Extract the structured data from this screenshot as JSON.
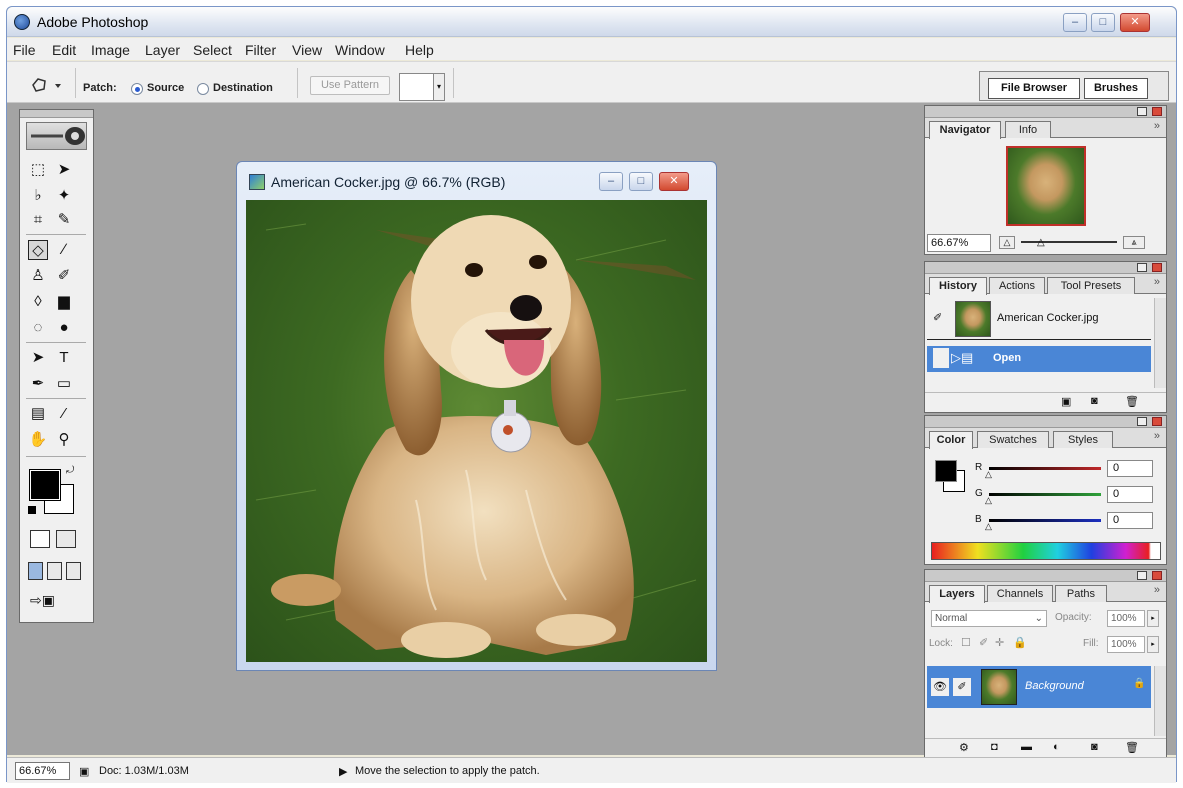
{
  "window": {
    "title": "Adobe Photoshop",
    "controls": {
      "minimize": "–",
      "maximize": "□",
      "close": "✕"
    }
  },
  "menu": {
    "items": [
      "File",
      "Edit",
      "Image",
      "Layer",
      "Select",
      "Filter",
      "View",
      "Window",
      "Help"
    ]
  },
  "options": {
    "tool_icon": "patch-tool-icon",
    "patch_label": "Patch:",
    "source_label": "Source",
    "destination_label": "Destination",
    "source_selected": true,
    "use_pattern_label": "Use Pattern",
    "dropdown_arrow": "▾",
    "well_tabs": [
      "File Browser",
      "Brushes"
    ]
  },
  "document": {
    "title": "American Cocker.jpg @ 66.7% (RGB)",
    "controls": {
      "minimize": "–",
      "maximize": "□",
      "close": "✕"
    },
    "image_subject": "cocker-spaniel-on-grass"
  },
  "panels": {
    "navigator": {
      "tabs": [
        "Navigator",
        "Info"
      ],
      "zoom_value": "66.67%",
      "menu_glyph": "»"
    },
    "history": {
      "tabs": [
        "History",
        "Actions",
        "Tool Presets"
      ],
      "snapshot_label": "American Cocker.jpg",
      "states": [
        "Open"
      ],
      "menu_glyph": "»"
    },
    "color": {
      "tabs": [
        "Color",
        "Swatches",
        "Styles"
      ],
      "channels": [
        {
          "label": "R",
          "value": "0",
          "color": "#c0282a"
        },
        {
          "label": "G",
          "value": "0",
          "color": "#2fa23a"
        },
        {
          "label": "B",
          "value": "0",
          "color": "#1c2fc0"
        }
      ],
      "menu_glyph": "»"
    },
    "layers": {
      "tabs": [
        "Layers",
        "Channels",
        "Paths"
      ],
      "blend_mode": "Normal",
      "opacity_label": "Opacity:",
      "opacity_value": "100%",
      "lock_label": "Lock:",
      "fill_label": "Fill:",
      "fill_value": "100%",
      "layer_name": "Background",
      "menu_glyph": "»"
    }
  },
  "status": {
    "zoom": "66.67%",
    "doc_info": "Doc: 1.03M/1.03M",
    "message": "Move the selection to apply the patch.",
    "play_glyph": "▶"
  },
  "colors": {
    "foreground": "#000000",
    "background": "#ffffff",
    "selection_highlight": "#4a86d6",
    "workspace": "#a4a4a4"
  }
}
